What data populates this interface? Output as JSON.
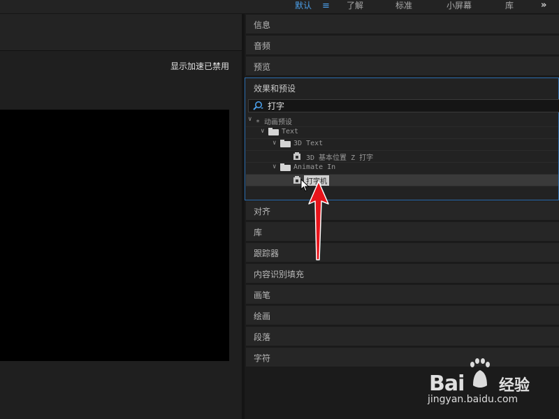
{
  "workspaces": {
    "items": [
      {
        "label": "默认",
        "active": true
      },
      {
        "label": "了解"
      },
      {
        "label": "标准"
      },
      {
        "label": "小屏幕"
      },
      {
        "label": "库"
      }
    ],
    "menu_icon": "hamburger-menu-icon",
    "more_icon": "double-chevron-right-icon"
  },
  "viewer": {
    "status_text": "显示加速已禁用"
  },
  "panels_top": [
    {
      "label": "信息"
    },
    {
      "label": "音频"
    },
    {
      "label": "预览"
    }
  ],
  "effects_presets": {
    "title": "效果和预设",
    "search": {
      "value": "打字",
      "icon": "search-icon"
    },
    "tree": {
      "root": "* 动画预设",
      "text_folder": "Text",
      "folder_3d": "3D Text",
      "preset_3d": "3D 基本位置 Z 打字",
      "folder_animate": "Animate In",
      "preset_selected": "打字机"
    }
  },
  "panels_bottom": [
    {
      "label": "对齐"
    },
    {
      "label": "库"
    },
    {
      "label": "跟踪器"
    },
    {
      "label": "内容识别填充"
    },
    {
      "label": "画笔"
    },
    {
      "label": "绘画"
    },
    {
      "label": "段落"
    },
    {
      "label": "字符"
    }
  ],
  "watermark": {
    "brand": "Bai",
    "brand_suffix": "经验",
    "url": "jingyan.baidu.com"
  },
  "colors": {
    "accent": "#4b9ee8",
    "focus_border": "#2d6fb0",
    "annotation_arrow": "#e8141b"
  }
}
